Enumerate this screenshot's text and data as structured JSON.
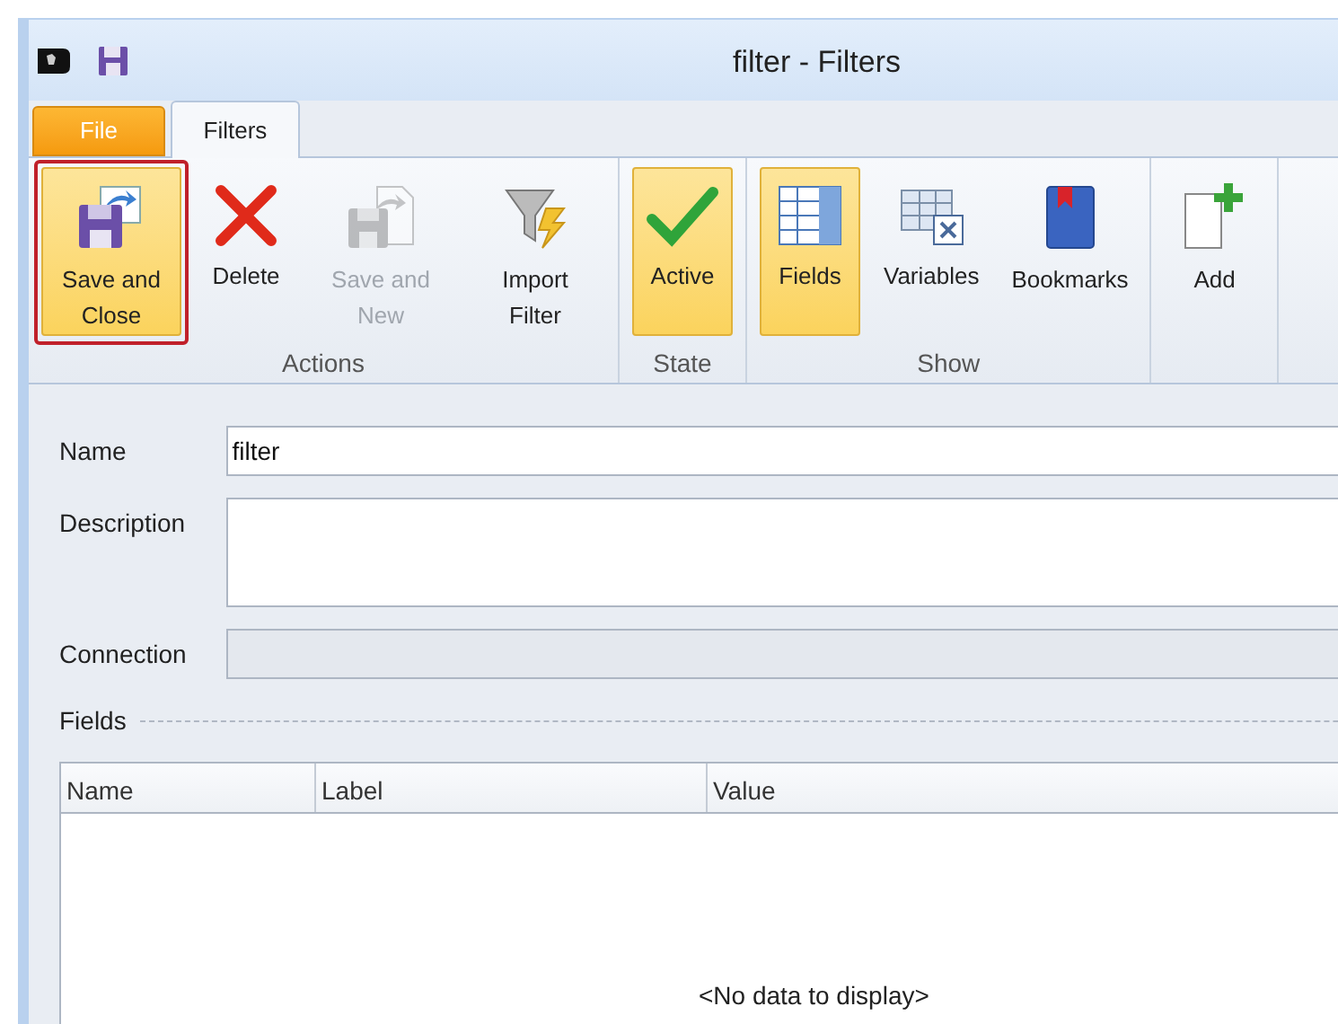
{
  "window": {
    "title": "filter - Filters"
  },
  "tabs": [
    {
      "label": "File",
      "kind": "file",
      "selected": false
    },
    {
      "label": "Filters",
      "kind": "tab",
      "selected": true
    }
  ],
  "ribbon_groups": [
    {
      "label": "Actions",
      "buttons": [
        {
          "label": "Save and Close",
          "selected": true,
          "disabled": false
        },
        {
          "label": "Delete",
          "selected": false,
          "disabled": false
        },
        {
          "label": "Save and New",
          "selected": false,
          "disabled": true
        },
        {
          "label": "Import Filter",
          "selected": false,
          "disabled": false
        }
      ]
    },
    {
      "label": "State",
      "buttons": [
        {
          "label": "Active",
          "selected": true,
          "disabled": false
        }
      ]
    },
    {
      "label": "Show",
      "buttons": [
        {
          "label": "Fields",
          "selected": true,
          "disabled": false
        },
        {
          "label": "Variables",
          "selected": false,
          "disabled": false
        },
        {
          "label": "Bookmarks",
          "selected": false,
          "disabled": false
        }
      ]
    },
    {
      "buttons": [
        {
          "label": "Add",
          "selected": false,
          "disabled": false
        }
      ]
    }
  ],
  "form": [
    {
      "label": "Name",
      "value": "filter",
      "kind": "text",
      "disabled": false
    },
    {
      "label": "Description",
      "kind": "multiline",
      "disabled": false
    },
    {
      "label": "Connection",
      "kind": "text",
      "disabled": true
    }
  ],
  "fields_section": {
    "title": "Fields",
    "columns": [
      "Name",
      "Label",
      "Value"
    ],
    "empty_text": "<No data to display>"
  }
}
